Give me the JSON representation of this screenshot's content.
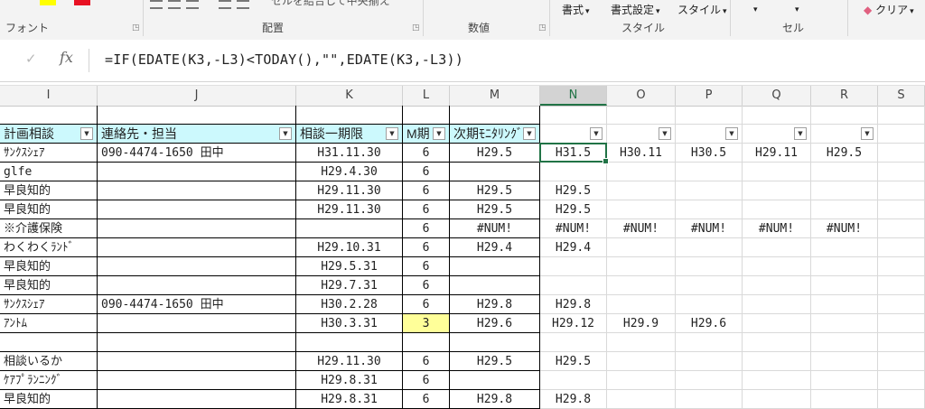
{
  "ribbon": {
    "groups": [
      {
        "label": "フォント"
      },
      {
        "label": "配置"
      },
      {
        "label": "数値"
      },
      {
        "label": "スタイル"
      },
      {
        "label": "セル"
      }
    ],
    "buttons": {
      "merge_center": "セルを結合して中央揃え",
      "format": "書式",
      "format_settings": "書式設定",
      "style": "スタイル",
      "clear": "クリア"
    },
    "colors": {
      "fill": "#ffff00",
      "font": "#e81123",
      "accent": "#217346"
    }
  },
  "formula_bar": {
    "cancel_icon": "check-icon",
    "fx_label": "fx",
    "formula": "=IF(EDATE(K3,-L3)<TODAY(),\"\",EDATE(K3,-L3))"
  },
  "columns": [
    {
      "letter": "I"
    },
    {
      "letter": "J"
    },
    {
      "letter": "K"
    },
    {
      "letter": "L"
    },
    {
      "letter": "M"
    },
    {
      "letter": "N",
      "selected": true
    },
    {
      "letter": "O"
    },
    {
      "letter": "P"
    },
    {
      "letter": "Q"
    },
    {
      "letter": "R"
    },
    {
      "letter": "S"
    }
  ],
  "table": {
    "headers": {
      "I": "計画相談",
      "J": "連絡先・担当",
      "K": "相談一期限",
      "L": "M期",
      "M": "次期ﾓﾆﾀﾘﾝｸﾞ"
    },
    "rows": [
      {
        "I": "ｻﾝｸｽｼｪｱ",
        "J": "090-4474-1650  田中",
        "K": "H31.11.30",
        "L": "6",
        "M": "H29.5",
        "N": "H31.5",
        "O": "H30.11",
        "P": "H30.5",
        "Q": "H29.11",
        "R": "H29.5"
      },
      {
        "I": "glfe",
        "J": "",
        "K": "H29.4.30",
        "L": "6",
        "M": "",
        "N": "",
        "O": "",
        "P": "",
        "Q": "",
        "R": ""
      },
      {
        "I": "早良知的",
        "J": "",
        "K": "H29.11.30",
        "L": "6",
        "M": "H29.5",
        "N": "H29.5",
        "O": "",
        "P": "",
        "Q": "",
        "R": ""
      },
      {
        "I": "早良知的",
        "J": "",
        "K": "H29.11.30",
        "L": "6",
        "M": "H29.5",
        "N": "H29.5",
        "O": "",
        "P": "",
        "Q": "",
        "R": ""
      },
      {
        "I": "※介護保険",
        "J": "",
        "K": "",
        "L": "6",
        "M": "#NUM!",
        "N": "#NUM!",
        "O": "#NUM!",
        "P": "#NUM!",
        "Q": "#NUM!",
        "R": "#NUM!"
      },
      {
        "I": "わくわくﾗﾝﾄﾞ",
        "J": "",
        "K": "H29.10.31",
        "L": "6",
        "M": "H29.4",
        "N": "H29.4",
        "O": "",
        "P": "",
        "Q": "",
        "R": ""
      },
      {
        "I": "早良知的",
        "J": "",
        "K": "H29.5.31",
        "L": "6",
        "M": "",
        "N": "",
        "O": "",
        "P": "",
        "Q": "",
        "R": ""
      },
      {
        "I": "早良知的",
        "J": "",
        "K": "H29.7.31",
        "L": "6",
        "M": "",
        "N": "",
        "O": "",
        "P": "",
        "Q": "",
        "R": ""
      },
      {
        "I": "ｻﾝｸｽｼｪｱ",
        "J": "090-4474-1650  田中",
        "K": "H30.2.28",
        "L": "6",
        "M": "H29.8",
        "N": "H29.8",
        "O": "",
        "P": "",
        "Q": "",
        "R": ""
      },
      {
        "I": "ｱﾝﾄﾑ",
        "J": "",
        "K": "H30.3.31",
        "L": "3",
        "M": "H29.6",
        "N": "H29.12",
        "O": "H29.9",
        "P": "H29.6",
        "Q": "",
        "R": "",
        "L_highlight": true
      },
      {
        "I": "",
        "J": "",
        "K": "",
        "L": "",
        "M": "",
        "N": "",
        "O": "",
        "P": "",
        "Q": "",
        "R": ""
      },
      {
        "I": "相談いるか",
        "J": "",
        "K": "H29.11.30",
        "L": "6",
        "M": "H29.5",
        "N": "H29.5",
        "O": "",
        "P": "",
        "Q": "",
        "R": ""
      },
      {
        "I": "ｹｱﾌﾟﾗﾝﾆﾝｸﾞ",
        "J": "",
        "K": "H29.8.31",
        "L": "6",
        "M": "",
        "N": "",
        "O": "",
        "P": "",
        "Q": "",
        "R": ""
      },
      {
        "I": "早良知的",
        "J": "",
        "K": "H29.8.31",
        "L": "6",
        "M": "H29.8",
        "N": "H29.8",
        "O": "",
        "P": "",
        "Q": "",
        "R": ""
      }
    ]
  }
}
